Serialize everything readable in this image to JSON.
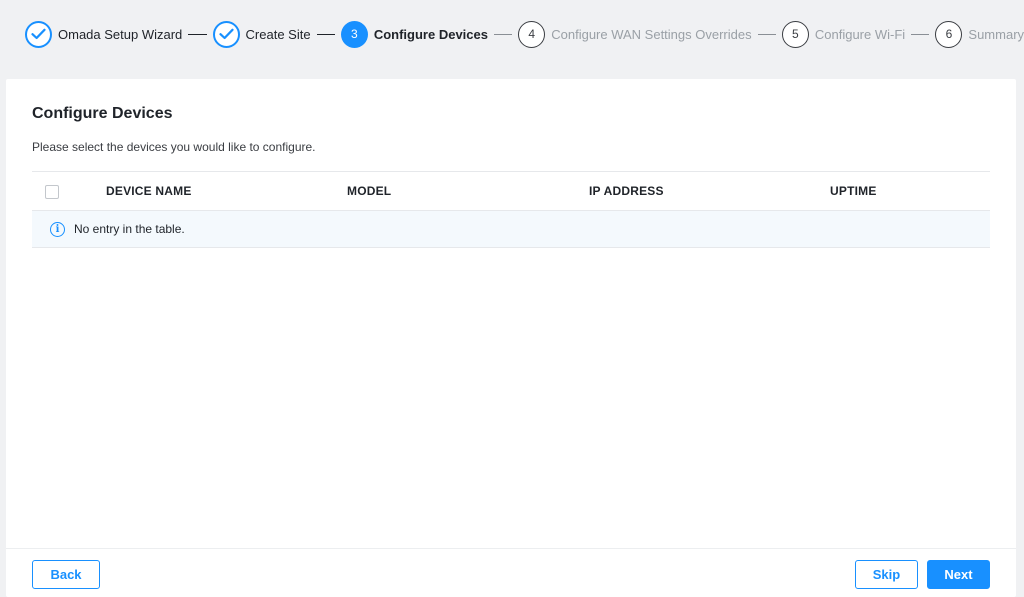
{
  "wizard": {
    "steps": [
      {
        "number": "",
        "label": "Omada Setup Wizard",
        "state": "done"
      },
      {
        "number": "",
        "label": "Create Site",
        "state": "done"
      },
      {
        "number": "3",
        "label": "Configure Devices",
        "state": "active"
      },
      {
        "number": "4",
        "label": "Configure WAN Settings Overrides",
        "state": "todo"
      },
      {
        "number": "5",
        "label": "Configure Wi-Fi",
        "state": "todo"
      },
      {
        "number": "6",
        "label": "Summary",
        "state": "todo"
      }
    ]
  },
  "page": {
    "title": "Configure Devices",
    "description": "Please select the devices you would like to configure."
  },
  "table": {
    "columns": [
      "DEVICE NAME",
      "MODEL",
      "IP ADDRESS",
      "UPTIME"
    ],
    "empty_message": "No entry in the table."
  },
  "footer": {
    "back_label": "Back",
    "skip_label": "Skip",
    "next_label": "Next"
  },
  "colors": {
    "accent": "#1890ff",
    "background": "#f0f1f3"
  }
}
